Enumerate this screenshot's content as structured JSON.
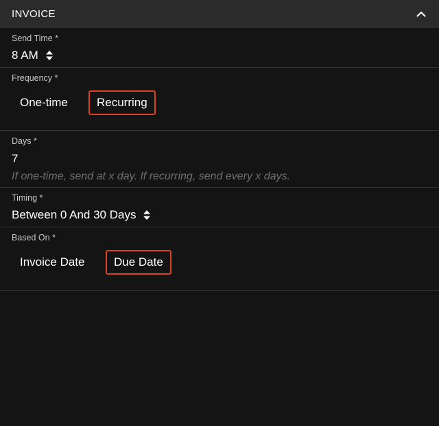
{
  "header": {
    "title": "INVOICE",
    "collapse_icon": "chevron-up-icon"
  },
  "send_time": {
    "label": "Send Time *",
    "value": "8 AM",
    "icon": "sort-icon"
  },
  "frequency": {
    "label": "Frequency *",
    "options": [
      "One-time",
      "Recurring"
    ],
    "selected": "Recurring"
  },
  "days": {
    "label": "Days *",
    "value": "7",
    "hint": "If one-time, send at x day. If recurring, send every x days."
  },
  "timing": {
    "label": "Timing *",
    "value": "Between 0 And 30 Days",
    "icon": "sort-icon"
  },
  "based_on": {
    "label": "Based On *",
    "options": [
      "Invoice Date",
      "Due Date"
    ],
    "selected": "Due Date"
  },
  "colors": {
    "selected_border": "#e0421f",
    "header_bg": "#2b2b2b",
    "panel_bg": "#141414"
  }
}
